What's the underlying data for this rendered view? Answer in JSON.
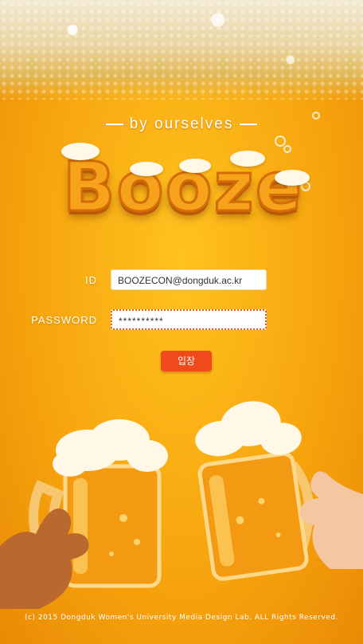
{
  "app": {
    "tagline": "by ourselves",
    "logo_text": "Booze"
  },
  "login": {
    "id_label": "ID",
    "id_value": "BOOZECON@dongduk.ac.kr",
    "password_label": "PASSWORD",
    "password_value": "**********",
    "submit_label": "입장"
  },
  "footer": {
    "copyright": "(c) 2015 Dongduk Women's University Media Design Lab. ALL Rights Reserved."
  },
  "colors": {
    "background": "#f7a60e",
    "accent_button": "#f04a1c",
    "foam": "#f3ead2"
  },
  "icons": [
    "beer-mug-left-icon",
    "beer-mug-right-icon",
    "hand-icon"
  ]
}
